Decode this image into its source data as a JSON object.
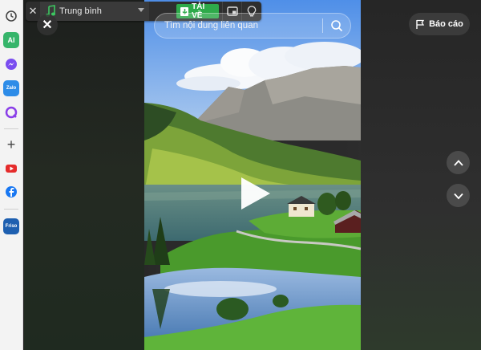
{
  "player": {
    "close_icon": "close-icon",
    "quality_label": "Trung bình",
    "quality_icon": "music-note-icon",
    "download_label": "TẢI VỀ",
    "pip_icon": "picture-in-picture-icon",
    "bulb_icon": "lightbulb-icon"
  },
  "search": {
    "placeholder": "Tìm nội dung liên quan"
  },
  "report": {
    "label": "Báo cáo"
  },
  "sidebar": {
    "items": [
      {
        "name": "history-icon",
        "label": ""
      },
      {
        "name": "ai-icon",
        "label": "AI"
      },
      {
        "name": "messenger-icon",
        "label": ""
      },
      {
        "name": "zalo-icon",
        "label": "Zalo"
      },
      {
        "name": "search-q-icon",
        "label": ""
      },
      {
        "name": "add-icon",
        "label": ""
      },
      {
        "name": "youtube-icon",
        "label": ""
      },
      {
        "name": "facebook-icon",
        "label": ""
      },
      {
        "name": "friso-icon",
        "label": "Friso"
      }
    ]
  },
  "colors": {
    "download_bg": "#2eaa4a",
    "music_icon": "#3cc760",
    "overlay_bg": "#2a2a2a"
  }
}
